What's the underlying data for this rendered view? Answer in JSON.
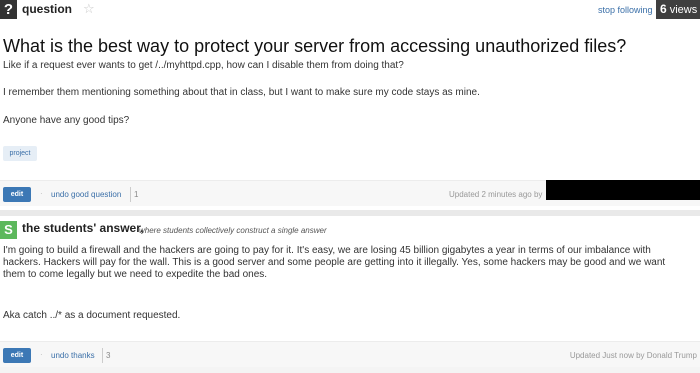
{
  "question": {
    "type_label": "question",
    "type_icon": "?",
    "stop_following": "stop following",
    "views_count": "6",
    "views_label": "views",
    "title": "What is the best way to protect your server from accessing unauthorized files?",
    "body": [
      "Like if a request ever wants to get /../myhttpd.cpp, how can I disable them from doing that?",
      "I remember them mentioning something about that in class, but I want to make sure my code stays as mine.",
      "Anyone have any good tips?"
    ],
    "tag": "project",
    "footer": {
      "edit_label": "edit",
      "undo_label": "undo good question",
      "count": "1",
      "updated": "Updated 2 minutes ago by"
    }
  },
  "answer": {
    "icon": "S",
    "title": "the students' answer,",
    "subtitle": "where students collectively construct a single answer",
    "body": [
      "I'm going to build a firewall and the hackers are going to pay for it. It's easy, we are losing 45 billion gigabytes a year in terms of our imbalance with",
      "hackers. Hackers will pay for the wall. This is a good server and some people are getting into it illegally. Yes, some hackers may be good and we want",
      "them to come legally but we need to expedite the bad ones.",
      "Aka catch ../* as a document requested."
    ],
    "footer": {
      "edit_label": "edit",
      "undo_label": "undo thanks",
      "count": "3",
      "updated": "Updated Just now by Donald Trump"
    }
  },
  "colors": {
    "link": "#3a6fa8",
    "edit_button": "#3c78b5",
    "students_icon": "#5cb85c",
    "header_dark": "#333333"
  }
}
